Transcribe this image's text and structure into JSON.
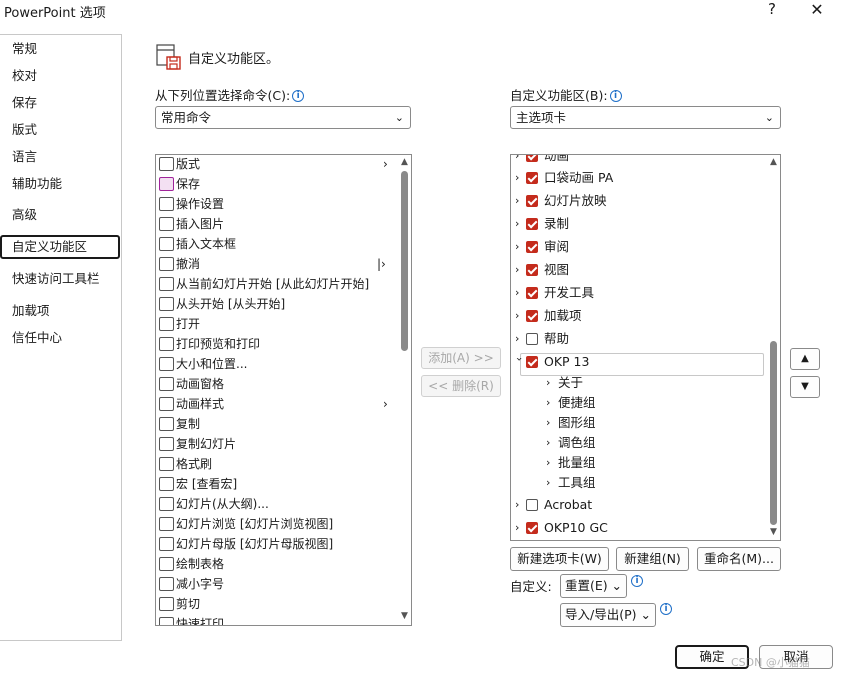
{
  "window": {
    "title": "PowerPoint 选项",
    "help_label": "?",
    "close_label": "✕"
  },
  "nav": {
    "items": [
      {
        "label": "常规",
        "active": false
      },
      {
        "label": "校对",
        "active": false
      },
      {
        "label": "保存",
        "active": false
      },
      {
        "label": "版式",
        "active": false
      },
      {
        "label": "语言",
        "active": false
      },
      {
        "label": "辅助功能",
        "active": false
      },
      {
        "label": "高级",
        "active": false
      },
      {
        "label": "自定义功能区",
        "active": true
      },
      {
        "label": "快速访问工具栏",
        "active": false
      },
      {
        "label": "加载项",
        "active": false
      },
      {
        "label": "信任中心",
        "active": false
      }
    ]
  },
  "main": {
    "heading": "自定义功能区。",
    "heading_icon": "ribbon-customize-icon",
    "left_label": "从下列位置选择命令(C):",
    "left_combo_value": "常用命令",
    "right_label": "自定义功能区(B):",
    "right_combo_value": "主选项卡",
    "info_glyph": "i"
  },
  "commands": [
    {
      "label": "版式",
      "icon": "layout-icon",
      "arrow": "›"
    },
    {
      "label": "保存",
      "icon": "save-icon",
      "arrow": ""
    },
    {
      "label": "操作设置",
      "icon": "action-settings-icon",
      "arrow": ""
    },
    {
      "label": "插入图片",
      "icon": "insert-picture-icon",
      "arrow": ""
    },
    {
      "label": "插入文本框",
      "icon": "text-box-icon",
      "arrow": ""
    },
    {
      "label": "撤消",
      "icon": "undo-icon",
      "arrow": "|›"
    },
    {
      "label": "从当前幻灯片开始 [从此幻灯片开始]",
      "icon": "slideshow-current-icon",
      "arrow": ""
    },
    {
      "label": "从头开始 [从头开始]",
      "icon": "slideshow-start-icon",
      "arrow": ""
    },
    {
      "label": "打开",
      "icon": "folder-open-icon",
      "arrow": ""
    },
    {
      "label": "打印预览和打印",
      "icon": "print-preview-icon",
      "arrow": ""
    },
    {
      "label": "大小和位置...",
      "icon": "size-position-icon",
      "arrow": ""
    },
    {
      "label": "动画窗格",
      "icon": "animation-pane-icon",
      "arrow": ""
    },
    {
      "label": "动画样式",
      "icon": "animation-style-icon",
      "arrow": "›"
    },
    {
      "label": "复制",
      "icon": "copy-icon",
      "arrow": ""
    },
    {
      "label": "复制幻灯片",
      "icon": "duplicate-slide-icon",
      "arrow": ""
    },
    {
      "label": "格式刷",
      "icon": "format-painter-icon",
      "arrow": ""
    },
    {
      "label": "宏 [查看宏]",
      "icon": "macro-icon",
      "arrow": ""
    },
    {
      "label": "幻灯片(从大纲)...",
      "icon": "slides-from-outline-icon",
      "arrow": ""
    },
    {
      "label": "幻灯片浏览 [幻灯片浏览视图]",
      "icon": "slide-sorter-icon",
      "arrow": ""
    },
    {
      "label": "幻灯片母版 [幻灯片母版视图]",
      "icon": "slide-master-icon",
      "arrow": ""
    },
    {
      "label": "绘制表格",
      "icon": "draw-table-icon",
      "arrow": ""
    },
    {
      "label": "减小字号",
      "icon": "decrease-font-icon",
      "arrow": ""
    },
    {
      "label": "剪切",
      "icon": "scissors-icon",
      "arrow": ""
    },
    {
      "label": "快速打印",
      "icon": "quick-print-icon",
      "arrow": ""
    }
  ],
  "middle": {
    "add_label": "添加(A) >>",
    "remove_label": "<< 删除(R)"
  },
  "tabs_tree": {
    "partial_top_label": "动画",
    "items": [
      {
        "label": "口袋动画 PA",
        "checked": true
      },
      {
        "label": "幻灯片放映",
        "checked": true
      },
      {
        "label": "录制",
        "checked": true
      },
      {
        "label": "审阅",
        "checked": true
      },
      {
        "label": "视图",
        "checked": true
      },
      {
        "label": "开发工具",
        "checked": true
      },
      {
        "label": "加载项",
        "checked": true
      },
      {
        "label": "帮助",
        "checked": false
      },
      {
        "label": "OKP 13",
        "checked": true
      }
    ],
    "okp_children": [
      "关于",
      "便捷组",
      "图形组",
      "调色组",
      "批量组",
      "工具组"
    ],
    "after_items": [
      {
        "label": "Acrobat",
        "checked": false
      },
      {
        "label": "OKP10 GC",
        "checked": true
      }
    ],
    "up_glyph": "▲",
    "down_glyph": "▼"
  },
  "bottom": {
    "new_tab_label": "新建选项卡(W)",
    "new_group_label": "新建组(N)",
    "rename_label": "重命名(M)...",
    "customize_label": "自定义:",
    "reset_label": "重置(E) ⌄",
    "import_export_label": "导入/导出(P) ⌄"
  },
  "footer": {
    "ok_label": "确定",
    "cancel_label": "取消",
    "watermark": "CSDN @小猫猫"
  }
}
